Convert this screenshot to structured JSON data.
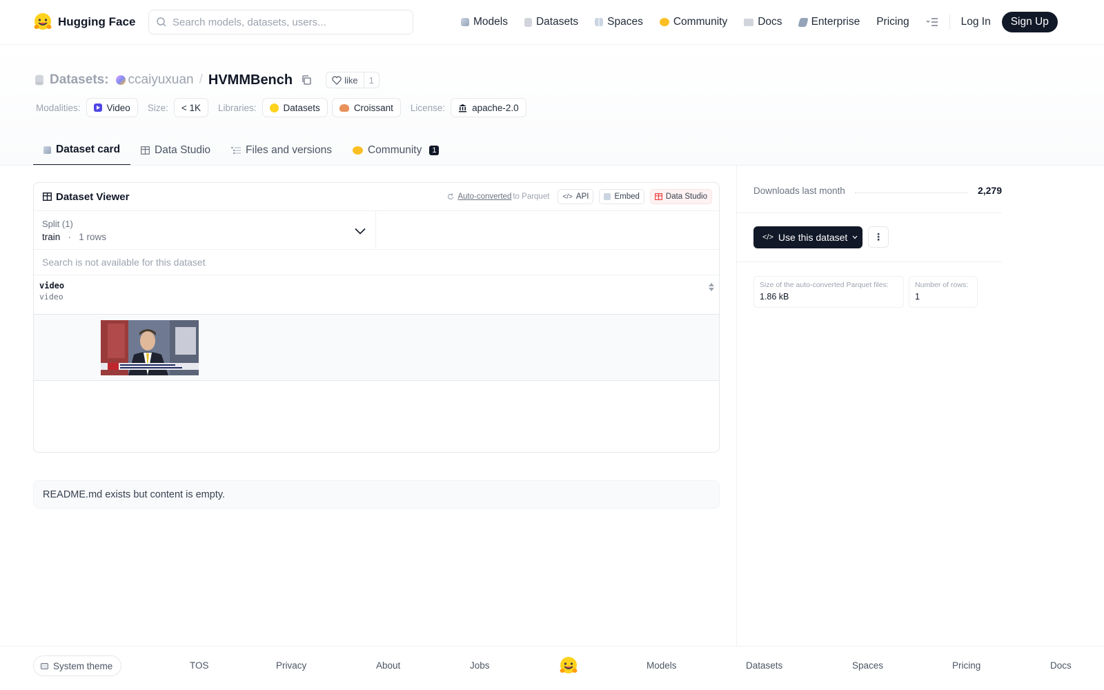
{
  "header": {
    "brand": "Hugging Face",
    "search_placeholder": "Search models, datasets, users...",
    "nav": [
      {
        "label": "Models",
        "icon": "cube-icon"
      },
      {
        "label": "Datasets",
        "icon": "database-icon"
      },
      {
        "label": "Spaces",
        "icon": "grid-icon"
      },
      {
        "label": "Community",
        "icon": "community-icon"
      },
      {
        "label": "Docs",
        "icon": "book-icon"
      },
      {
        "label": "Enterprise",
        "icon": "enterprise-icon"
      },
      {
        "label": "Pricing",
        "icon": ""
      }
    ],
    "login": "Log In",
    "signup": "Sign Up"
  },
  "repo": {
    "kind": "Datasets:",
    "owner": "ccaiyuxuan",
    "name": "HVMMBench",
    "like_label": "like",
    "like_count": "1",
    "modalities_label": "Modalities:",
    "modality": "Video",
    "size_label": "Size:",
    "size": "< 1K",
    "libraries_label": "Libraries:",
    "libraries": [
      "Datasets",
      "Croissant"
    ],
    "license_label": "License:",
    "license": "apache-2.0"
  },
  "tabs": [
    {
      "label": "Dataset card",
      "active": true
    },
    {
      "label": "Data Studio",
      "active": false
    },
    {
      "label": "Files and versions",
      "active": false
    },
    {
      "label": "Community",
      "active": false,
      "badge": "1"
    }
  ],
  "viewer": {
    "title": "Dataset Viewer",
    "auto_converted": "Auto-converted",
    "to_parquet": "to Parquet",
    "api": "API",
    "embed": "Embed",
    "data_studio": "Data Studio",
    "split_label": "Split (1)",
    "split_name": "train",
    "split_rows": "1 rows",
    "search_unavailable": "Search is not available for this dataset",
    "column_name": "video",
    "column_type": "video"
  },
  "readme": "README.md exists but content is empty.",
  "sidebar": {
    "downloads_label": "Downloads last month",
    "downloads_value": "2,279",
    "use_dataset": "Use this dataset",
    "parquet_size_label": "Size of the auto-converted Parquet files:",
    "parquet_size_value": "1.86 kB",
    "rows_label": "Number of rows:",
    "rows_value": "1"
  },
  "footer": {
    "theme": "System theme",
    "links": [
      "TOS",
      "Privacy",
      "About",
      "Jobs",
      "Models",
      "Datasets",
      "Spaces",
      "Pricing",
      "Docs"
    ]
  }
}
